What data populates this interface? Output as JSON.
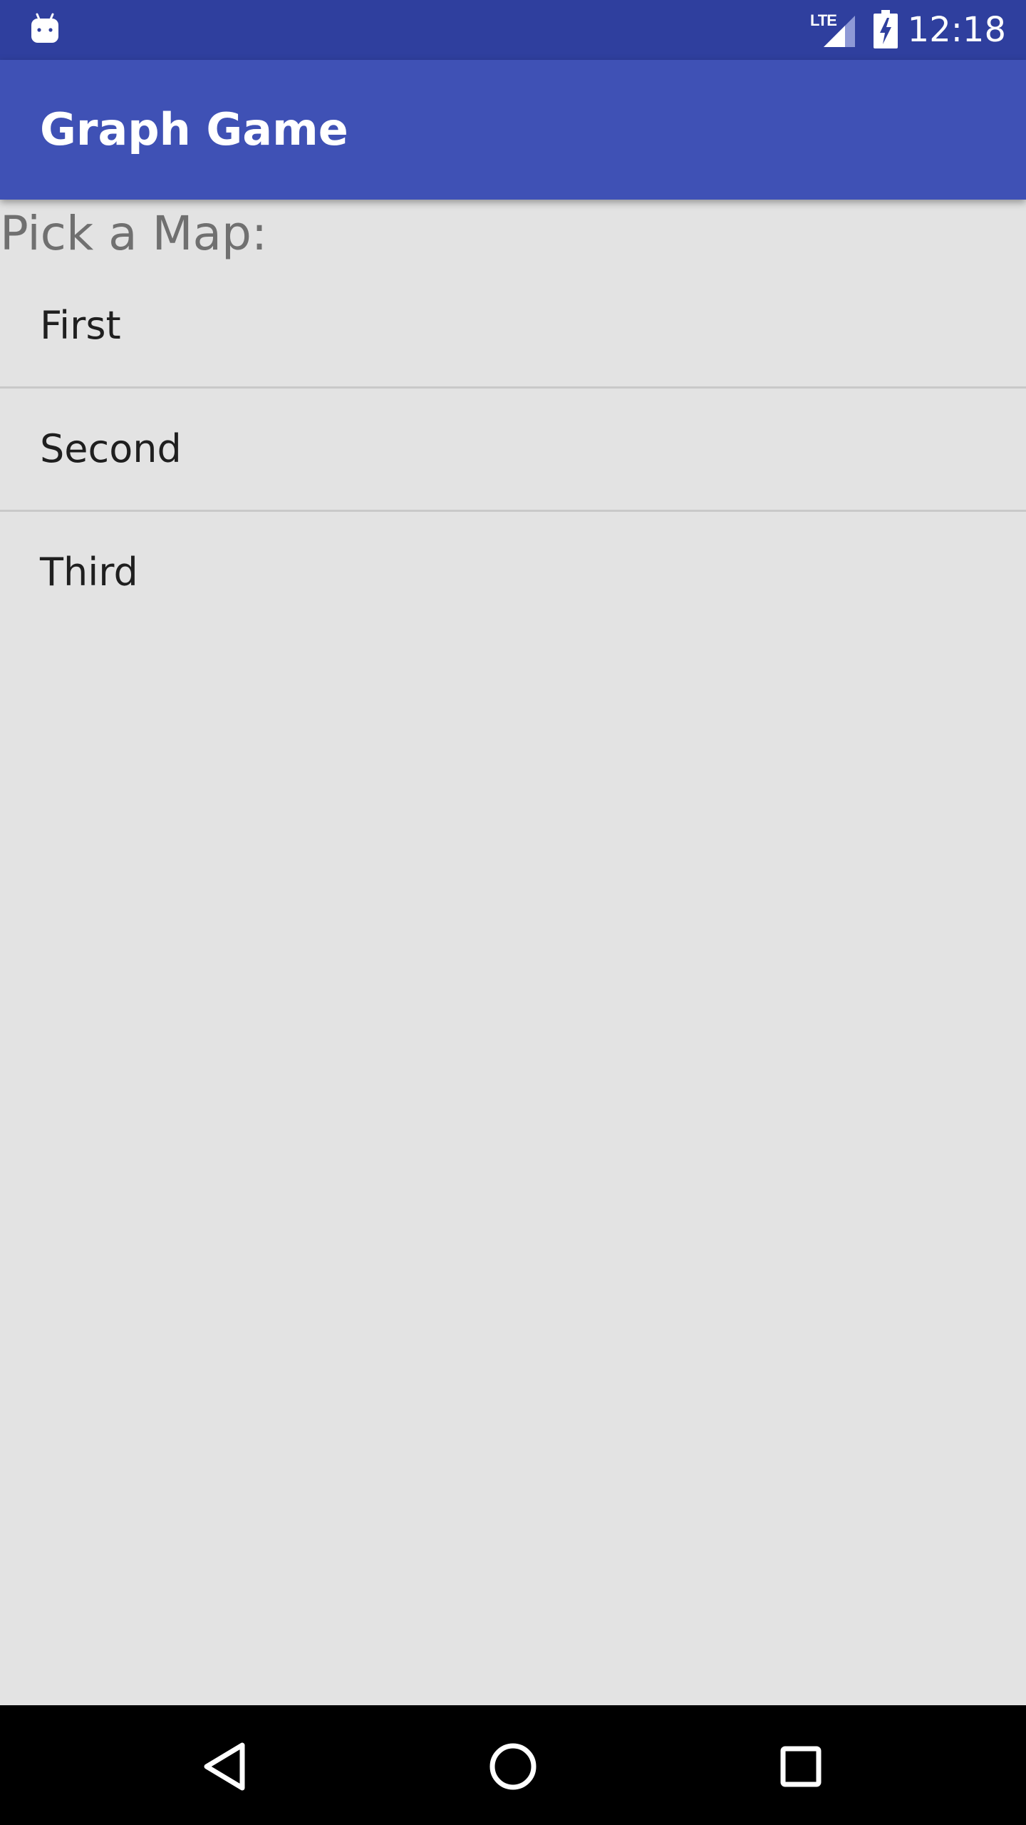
{
  "status_bar": {
    "network_label": "LTE",
    "time": "12:18",
    "icons": [
      "android-notification-icon",
      "lte-signal-icon",
      "battery-charging-icon"
    ]
  },
  "app_bar": {
    "title": "Graph Game",
    "color": "#3f51b5"
  },
  "main": {
    "prompt": "Pick a Map:",
    "maps": [
      {
        "label": "First"
      },
      {
        "label": "Second"
      },
      {
        "label": "Third"
      }
    ]
  },
  "nav_bar": {
    "buttons": [
      "back-icon",
      "home-icon",
      "recents-icon"
    ]
  },
  "colors": {
    "status_bar": "#2f3f9e",
    "app_bar": "#3f51b5",
    "background": "#e3e3e3",
    "divider": "#c9c9c9"
  }
}
